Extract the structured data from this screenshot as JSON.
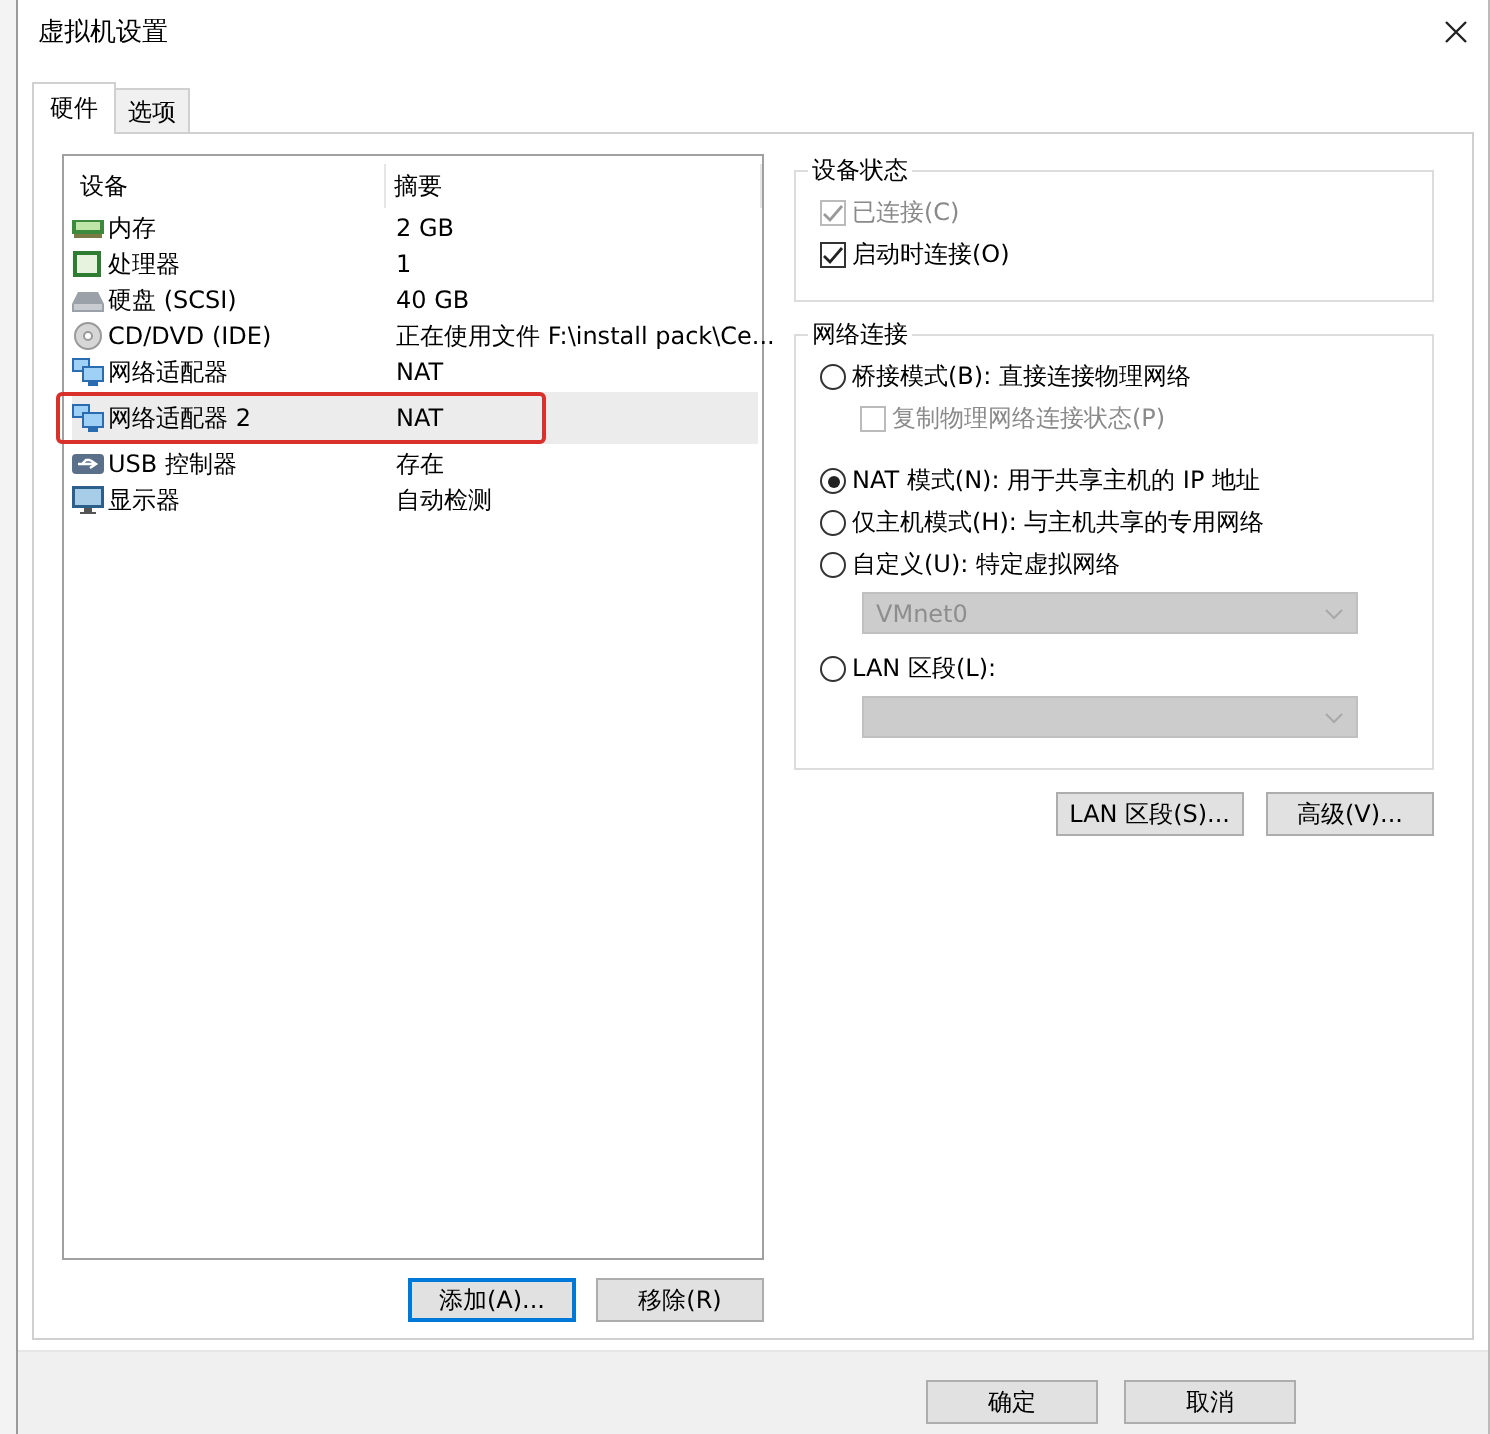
{
  "window": {
    "title": "虚拟机设置"
  },
  "tabs": [
    {
      "label": "硬件",
      "selected": true
    },
    {
      "label": "选项",
      "selected": false
    }
  ],
  "device_list": {
    "columns": [
      "设备",
      "摘要"
    ],
    "rows": [
      {
        "kind": "memory",
        "device": "内存",
        "summary": "2 GB",
        "selected": false,
        "highlighted": false
      },
      {
        "kind": "cpu",
        "device": "处理器",
        "summary": "1",
        "selected": false,
        "highlighted": false
      },
      {
        "kind": "disk",
        "device": "硬盘 (SCSI)",
        "summary": "40 GB",
        "selected": false,
        "highlighted": false
      },
      {
        "kind": "cdrom",
        "device": "CD/DVD (IDE)",
        "summary": "正在使用文件 F:\\install pack\\Ce...",
        "selected": false,
        "highlighted": false
      },
      {
        "kind": "network",
        "device": "网络适配器",
        "summary": "NAT",
        "selected": false,
        "highlighted": false
      },
      {
        "kind": "network",
        "device": "网络适配器 2",
        "summary": "NAT",
        "selected": true,
        "highlighted": true
      },
      {
        "kind": "usb",
        "device": "USB 控制器",
        "summary": "存在",
        "selected": false,
        "highlighted": false
      },
      {
        "kind": "display",
        "device": "显示器",
        "summary": "自动检测",
        "selected": false,
        "highlighted": false
      }
    ]
  },
  "list_buttons": [
    {
      "label": "添加(A)...",
      "focused": true
    },
    {
      "label": "移除(R)",
      "focused": false
    }
  ],
  "device_status": {
    "title": "设备状态",
    "options": [
      {
        "label": "已连接(C)",
        "checked": true,
        "disabled": true
      },
      {
        "label": "启动时连接(O)",
        "checked": true,
        "disabled": false
      }
    ]
  },
  "network_connection": {
    "title": "网络连接",
    "options": [
      {
        "kind": "radio",
        "label": "桥接模式(B): 直接连接物理网络",
        "selected": false
      },
      {
        "kind": "checkbox",
        "label": "复制物理网络连接状态(P)",
        "checked": false,
        "disabled": true
      },
      {
        "kind": "radio",
        "label": "NAT 模式(N): 用于共享主机的 IP 地址",
        "selected": true
      },
      {
        "kind": "radio",
        "label": "仅主机模式(H): 与主机共享的专用网络",
        "selected": false
      },
      {
        "kind": "radio",
        "label": "自定义(U): 特定虚拟网络",
        "selected": false
      },
      {
        "kind": "dropdown",
        "value": "VMnet0",
        "disabled": true
      },
      {
        "kind": "radio",
        "label": "LAN 区段(L):",
        "selected": false
      },
      {
        "kind": "dropdown",
        "disabled": true
      }
    ]
  },
  "network_buttons": [
    "LAN 区段(S)...",
    "高级(V)..."
  ],
  "footer_buttons": [
    "确定",
    "取消"
  ]
}
